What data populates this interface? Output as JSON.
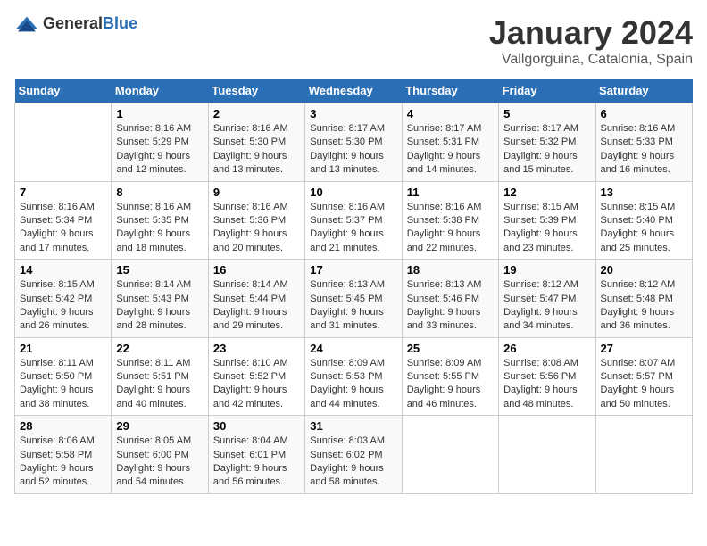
{
  "logo": {
    "general": "General",
    "blue": "Blue"
  },
  "title": "January 2024",
  "subtitle": "Vallgorguina, Catalonia, Spain",
  "weekdays": [
    "Sunday",
    "Monday",
    "Tuesday",
    "Wednesday",
    "Thursday",
    "Friday",
    "Saturday"
  ],
  "weeks": [
    [
      {
        "day": "",
        "info": ""
      },
      {
        "day": "1",
        "info": "Sunrise: 8:16 AM\nSunset: 5:29 PM\nDaylight: 9 hours\nand 12 minutes."
      },
      {
        "day": "2",
        "info": "Sunrise: 8:16 AM\nSunset: 5:30 PM\nDaylight: 9 hours\nand 13 minutes."
      },
      {
        "day": "3",
        "info": "Sunrise: 8:17 AM\nSunset: 5:30 PM\nDaylight: 9 hours\nand 13 minutes."
      },
      {
        "day": "4",
        "info": "Sunrise: 8:17 AM\nSunset: 5:31 PM\nDaylight: 9 hours\nand 14 minutes."
      },
      {
        "day": "5",
        "info": "Sunrise: 8:17 AM\nSunset: 5:32 PM\nDaylight: 9 hours\nand 15 minutes."
      },
      {
        "day": "6",
        "info": "Sunrise: 8:16 AM\nSunset: 5:33 PM\nDaylight: 9 hours\nand 16 minutes."
      }
    ],
    [
      {
        "day": "7",
        "info": "Sunrise: 8:16 AM\nSunset: 5:34 PM\nDaylight: 9 hours\nand 17 minutes."
      },
      {
        "day": "8",
        "info": "Sunrise: 8:16 AM\nSunset: 5:35 PM\nDaylight: 9 hours\nand 18 minutes."
      },
      {
        "day": "9",
        "info": "Sunrise: 8:16 AM\nSunset: 5:36 PM\nDaylight: 9 hours\nand 20 minutes."
      },
      {
        "day": "10",
        "info": "Sunrise: 8:16 AM\nSunset: 5:37 PM\nDaylight: 9 hours\nand 21 minutes."
      },
      {
        "day": "11",
        "info": "Sunrise: 8:16 AM\nSunset: 5:38 PM\nDaylight: 9 hours\nand 22 minutes."
      },
      {
        "day": "12",
        "info": "Sunrise: 8:15 AM\nSunset: 5:39 PM\nDaylight: 9 hours\nand 23 minutes."
      },
      {
        "day": "13",
        "info": "Sunrise: 8:15 AM\nSunset: 5:40 PM\nDaylight: 9 hours\nand 25 minutes."
      }
    ],
    [
      {
        "day": "14",
        "info": "Sunrise: 8:15 AM\nSunset: 5:42 PM\nDaylight: 9 hours\nand 26 minutes."
      },
      {
        "day": "15",
        "info": "Sunrise: 8:14 AM\nSunset: 5:43 PM\nDaylight: 9 hours\nand 28 minutes."
      },
      {
        "day": "16",
        "info": "Sunrise: 8:14 AM\nSunset: 5:44 PM\nDaylight: 9 hours\nand 29 minutes."
      },
      {
        "day": "17",
        "info": "Sunrise: 8:13 AM\nSunset: 5:45 PM\nDaylight: 9 hours\nand 31 minutes."
      },
      {
        "day": "18",
        "info": "Sunrise: 8:13 AM\nSunset: 5:46 PM\nDaylight: 9 hours\nand 33 minutes."
      },
      {
        "day": "19",
        "info": "Sunrise: 8:12 AM\nSunset: 5:47 PM\nDaylight: 9 hours\nand 34 minutes."
      },
      {
        "day": "20",
        "info": "Sunrise: 8:12 AM\nSunset: 5:48 PM\nDaylight: 9 hours\nand 36 minutes."
      }
    ],
    [
      {
        "day": "21",
        "info": "Sunrise: 8:11 AM\nSunset: 5:50 PM\nDaylight: 9 hours\nand 38 minutes."
      },
      {
        "day": "22",
        "info": "Sunrise: 8:11 AM\nSunset: 5:51 PM\nDaylight: 9 hours\nand 40 minutes."
      },
      {
        "day": "23",
        "info": "Sunrise: 8:10 AM\nSunset: 5:52 PM\nDaylight: 9 hours\nand 42 minutes."
      },
      {
        "day": "24",
        "info": "Sunrise: 8:09 AM\nSunset: 5:53 PM\nDaylight: 9 hours\nand 44 minutes."
      },
      {
        "day": "25",
        "info": "Sunrise: 8:09 AM\nSunset: 5:55 PM\nDaylight: 9 hours\nand 46 minutes."
      },
      {
        "day": "26",
        "info": "Sunrise: 8:08 AM\nSunset: 5:56 PM\nDaylight: 9 hours\nand 48 minutes."
      },
      {
        "day": "27",
        "info": "Sunrise: 8:07 AM\nSunset: 5:57 PM\nDaylight: 9 hours\nand 50 minutes."
      }
    ],
    [
      {
        "day": "28",
        "info": "Sunrise: 8:06 AM\nSunset: 5:58 PM\nDaylight: 9 hours\nand 52 minutes."
      },
      {
        "day": "29",
        "info": "Sunrise: 8:05 AM\nSunset: 6:00 PM\nDaylight: 9 hours\nand 54 minutes."
      },
      {
        "day": "30",
        "info": "Sunrise: 8:04 AM\nSunset: 6:01 PM\nDaylight: 9 hours\nand 56 minutes."
      },
      {
        "day": "31",
        "info": "Sunrise: 8:03 AM\nSunset: 6:02 PM\nDaylight: 9 hours\nand 58 minutes."
      },
      {
        "day": "",
        "info": ""
      },
      {
        "day": "",
        "info": ""
      },
      {
        "day": "",
        "info": ""
      }
    ]
  ]
}
